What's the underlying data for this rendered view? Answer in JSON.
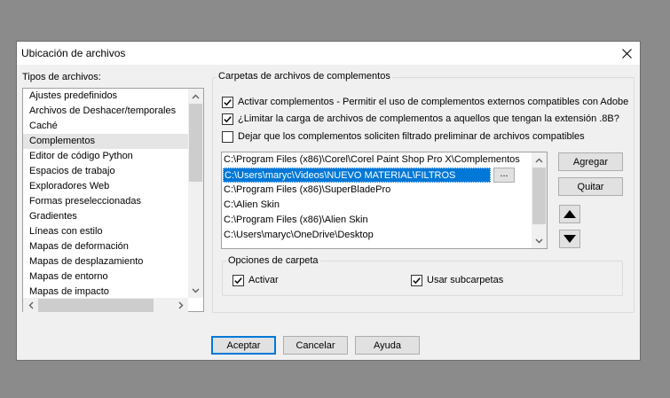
{
  "dialog": {
    "title": "Ubicación de archivos"
  },
  "file_types": {
    "label": "Tipos de archivos:",
    "items": [
      "Ajustes predefinidos",
      "Archivos de Deshacer/temporales",
      "Caché",
      "Complementos",
      "Editor de código Python",
      "Espacios de trabajo",
      "Exploradores Web",
      "Formas preseleccionadas",
      "Gradientes",
      "Líneas con estilo",
      "Mapas de deformación",
      "Mapas de desplazamiento",
      "Mapas de entorno",
      "Mapas de impacto"
    ],
    "selected_index": 3
  },
  "plugins_group": {
    "title": "Carpetas de archivos de complementos",
    "options": [
      {
        "label": "Activar complementos - Permitir el uso de complementos externos compatibles con Adobe",
        "checked": true
      },
      {
        "label": "¿Limitar la carga de archivos de complementos a aquellos que tengan la extensión .8B?",
        "checked": true
      },
      {
        "label": "Dejar que los complementos soliciten filtrado preliminar de archivos compatibles",
        "checked": false
      }
    ],
    "folders": [
      "C:\\Program Files (x86)\\Corel\\Corel Paint Shop Pro X\\Complementos",
      "C:\\Users\\maryc\\Videos\\NUEVO MATERIAL\\FILTROS",
      "C:\\Program Files (x86)\\SuperBladePro",
      "C:\\Alien Skin",
      "C:\\Program Files (x86)\\Alien Skin",
      "C:\\Users\\maryc\\OneDrive\\Desktop"
    ],
    "editing_index": 1,
    "browse_label": "...",
    "add_label": "Agregar",
    "remove_label": "Quitar"
  },
  "folder_options": {
    "title": "Opciones de carpeta",
    "enable_label": "Activar",
    "enable_checked": true,
    "subfolders_label": "Usar subcarpetas",
    "subfolders_checked": true
  },
  "footer": {
    "ok_label": "Aceptar",
    "cancel_label": "Cancelar",
    "help_label": "Ayuda"
  }
}
